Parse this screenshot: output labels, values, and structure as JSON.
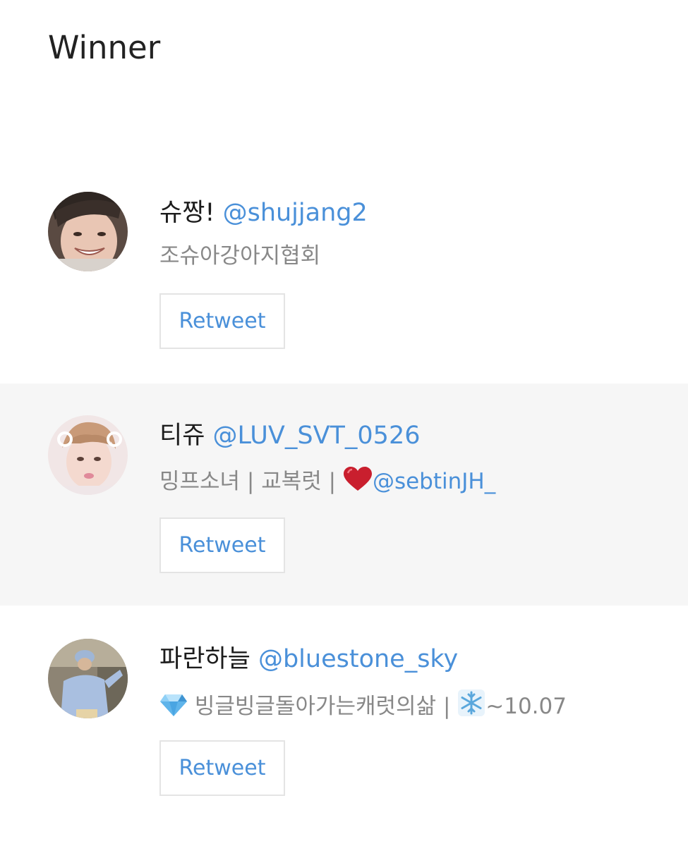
{
  "page": {
    "title": "Winner"
  },
  "colors": {
    "accent": "#4a90d9",
    "muted_text": "#888888",
    "shaded_row": "#f6f6f6",
    "button_border": "#e4e4e4"
  },
  "winners": [
    {
      "display_name": "슈짱!",
      "handle": "@shujjang2",
      "bio": {
        "text": "조슈아강아지협회"
      },
      "button_label": "Retweet",
      "avatar_icon": "avatar-photo"
    },
    {
      "display_name": "티쥬",
      "handle": "@LUV_SVT_0526",
      "bio": {
        "text": "밍프소녀 | 교복럿 | ",
        "emoji": "heart-icon",
        "mention": "@sebtinJH_"
      },
      "button_label": "Retweet",
      "avatar_icon": "avatar-photo"
    },
    {
      "display_name": "파란하늘",
      "handle": "@bluestone_sky",
      "bio": {
        "emoji1": "gem-icon",
        "text": " 빙글빙글돌아가는캐럿의삶 | ",
        "emoji2": "snowflake-icon",
        "text2": "~10.07"
      },
      "button_label": "Retweet",
      "avatar_icon": "avatar-photo"
    }
  ]
}
